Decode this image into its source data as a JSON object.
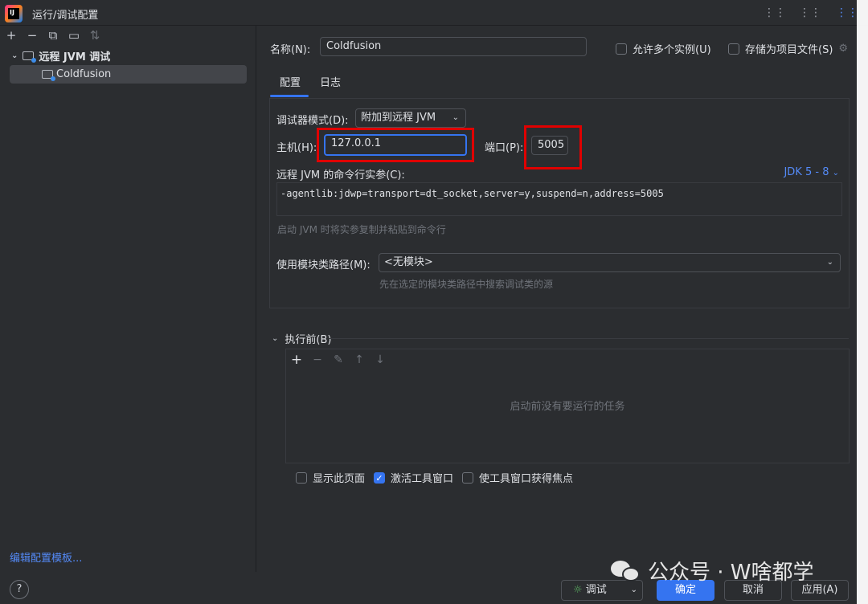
{
  "window": {
    "title": "运行/调试配置"
  },
  "left": {
    "tree_root": "远程 JVM 调试",
    "tree_child": "Coldfusion",
    "edit_templates": "编辑配置模板..."
  },
  "form": {
    "name_label": "名称(N):",
    "name_value": "Coldfusion",
    "allow_multiple": "允许多个实例(U)",
    "store_as_file": "存储为项目文件(S)",
    "tabs": [
      "配置",
      "日志"
    ],
    "debugger_mode_label": "调试器模式(D):",
    "debugger_mode_value": "附加到远程 JVM",
    "host_label": "主机(H):",
    "host_value": "127.0.0.1",
    "port_label": "端口(P):",
    "port_value": "5005",
    "cmd_args_label": "远程 JVM 的命令行实参(C):",
    "jdk_version": "JDK 5 - 8",
    "cmd_args_value": "-agentlib:jdwp=transport=dt_socket,server=y,suspend=n,address=5005",
    "cmd_hint": "启动 JVM 时将实参复制并粘贴到命令行",
    "module_label": "使用模块类路径(M):",
    "module_value": "<无模块>",
    "module_hint": "先在选定的模块类路径中搜索调试类的源"
  },
  "before_launch": {
    "title": "执行前(B)",
    "empty": "启动前没有要运行的任务",
    "show_page": "显示此页面",
    "activate_tool": "激活工具窗口",
    "focus_tool": "使工具窗口获得焦点"
  },
  "footer": {
    "debug": "调试",
    "ok": "确定",
    "cancel": "取消",
    "apply": "应用(A)"
  },
  "watermark": "公众号 · W啥都学",
  "colors": {
    "accent": "#3574f0",
    "highlight": "#e00000",
    "link": "#548af7"
  }
}
